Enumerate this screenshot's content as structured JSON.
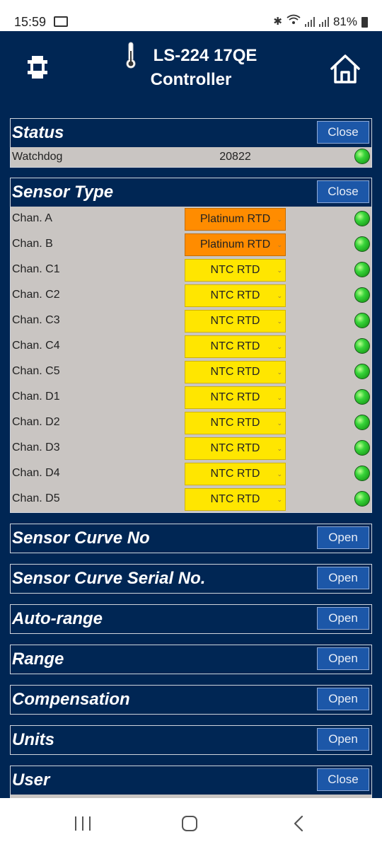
{
  "statusbar": {
    "time": "15:59",
    "battery": "81%"
  },
  "header": {
    "title_line1": "LS-224 17QE",
    "title_line2": "Controller"
  },
  "status": {
    "title": "Status",
    "button": "Close",
    "rows": [
      {
        "label": "Watchdog",
        "value": "20822",
        "led": "green"
      }
    ]
  },
  "sensor_type": {
    "title": "Sensor Type",
    "button": "Close",
    "rows": [
      {
        "label": "Chan. A",
        "value": "Platinum RTD",
        "color": "orange",
        "led": "green"
      },
      {
        "label": "Chan. B",
        "value": "Platinum RTD",
        "color": "orange",
        "led": "green"
      },
      {
        "label": "Chan. C1",
        "value": "NTC RTD",
        "color": "yellow",
        "led": "green"
      },
      {
        "label": "Chan. C2",
        "value": "NTC RTD",
        "color": "yellow",
        "led": "green"
      },
      {
        "label": "Chan. C3",
        "value": "NTC RTD",
        "color": "yellow",
        "led": "green"
      },
      {
        "label": "Chan. C4",
        "value": "NTC RTD",
        "color": "yellow",
        "led": "green"
      },
      {
        "label": "Chan. C5",
        "value": "NTC RTD",
        "color": "yellow",
        "led": "green"
      },
      {
        "label": "Chan. D1",
        "value": "NTC RTD",
        "color": "yellow",
        "led": "green"
      },
      {
        "label": "Chan. D2",
        "value": "NTC RTD",
        "color": "yellow",
        "led": "green"
      },
      {
        "label": "Chan. D3",
        "value": "NTC RTD",
        "color": "yellow",
        "led": "green"
      },
      {
        "label": "Chan. D4",
        "value": "NTC RTD",
        "color": "yellow",
        "led": "green"
      },
      {
        "label": "Chan. D5",
        "value": "NTC RTD",
        "color": "yellow",
        "led": "green"
      }
    ]
  },
  "collapsed_sections": [
    {
      "title": "Sensor Curve No",
      "button": "Open"
    },
    {
      "title": "Sensor Curve Serial No.",
      "button": "Open"
    },
    {
      "title": "Auto-range",
      "button": "Open"
    },
    {
      "title": "Range",
      "button": "Open"
    },
    {
      "title": "Compensation",
      "button": "Open"
    },
    {
      "title": "Units",
      "button": "Open"
    }
  ],
  "user": {
    "title": "User",
    "button": "Close"
  },
  "colors": {
    "background": "#002654",
    "button": "#1c57a8",
    "panel": "#c9c5c2",
    "orange": "#ff8c00",
    "yellow": "#ffe600",
    "led_green": "#38d43a"
  },
  "icons": [
    "photo-icon",
    "bluetooth-icon",
    "wifi-icon",
    "signal-icon",
    "battery-icon",
    "gear-logo-icon",
    "thermometer-icon",
    "home-icon",
    "recents-icon",
    "home-nav-icon",
    "back-icon"
  ]
}
